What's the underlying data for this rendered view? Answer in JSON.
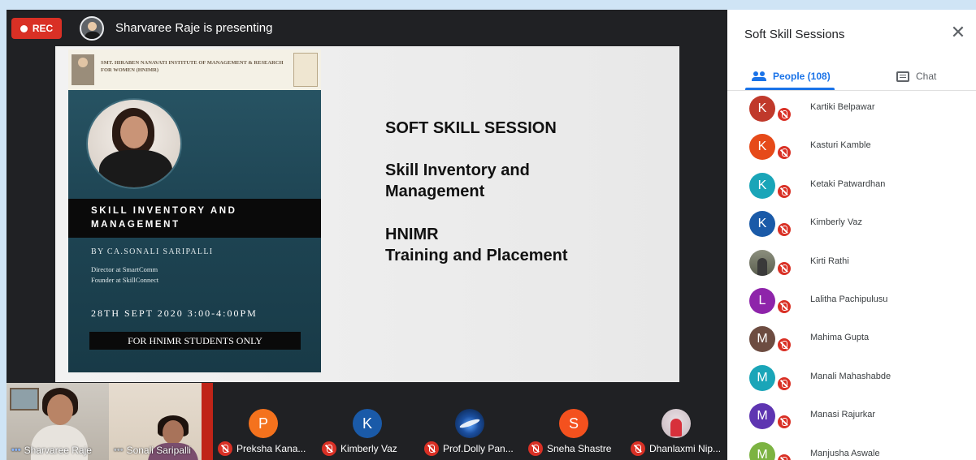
{
  "meeting": {
    "rec_label": "REC",
    "presenting_text": "Sharvaree Raje is presenting"
  },
  "slide": {
    "poster": {
      "institute": "SMT. HIRABEN NANAVATI INSTITUTE OF MANAGEMENT & RESEARCH FOR WOMEN (HNIMR)",
      "title_line1": "SKILL INVENTORY AND",
      "title_line2": "MANAGEMENT",
      "by": "BY CA.SONALI SARIPALLI",
      "role1": "Director at SmartComm",
      "role2": "Founder at SkillConnect",
      "date": "28TH SEPT 2020 3:00-4:00PM",
      "students": "FOR HNIMR STUDENTS ONLY"
    },
    "heading": "SOFT SKILL SESSION",
    "topic_line1": "Skill Inventory and",
    "topic_line2": "Management",
    "org_line1": "HNIMR",
    "org_line2": "Training and Placement"
  },
  "tiles": {
    "video": [
      {
        "name": "Sharvaree Raje"
      },
      {
        "name": "Sonali Saripalli"
      }
    ],
    "participants": [
      {
        "initial": "P",
        "name": "Preksha Kana...",
        "color": "#f4721d",
        "avatar": "letter"
      },
      {
        "initial": "K",
        "name": "Kimberly Vaz",
        "color": "#1a5aa8",
        "avatar": "letter"
      },
      {
        "initial": "",
        "name": "Prof.Dolly Pan...",
        "color": "#0f2f62",
        "avatar": "dolly"
      },
      {
        "initial": "S",
        "name": "Sneha Shastre",
        "color": "#f4511e",
        "avatar": "letter"
      },
      {
        "initial": "",
        "name": "Dhanlaxmi Nip...",
        "color": "#c9bcc2",
        "avatar": "dhan"
      }
    ]
  },
  "panel": {
    "title": "Soft Skill Sessions",
    "close_label": "✕",
    "people_tab": "People (108)",
    "chat_tab": "Chat",
    "people": [
      {
        "initial": "K",
        "name": "Kartiki Belpawar",
        "color": "#c0392b",
        "avatar": "letter"
      },
      {
        "initial": "K",
        "name": "Kasturi Kamble",
        "color": "#e64a19",
        "avatar": "letter"
      },
      {
        "initial": "K",
        "name": "Ketaki Patwardhan",
        "color": "#1aa5b8",
        "avatar": "letter"
      },
      {
        "initial": "K",
        "name": "Kimberly Vaz",
        "color": "#1a5aa8",
        "avatar": "letter"
      },
      {
        "initial": "",
        "name": "Kirti Rathi",
        "color": "#7a7d6c",
        "avatar": "photo"
      },
      {
        "initial": "L",
        "name": "Lalitha Pachipulusu",
        "color": "#8e24aa",
        "avatar": "letter"
      },
      {
        "initial": "M",
        "name": "Mahima Gupta",
        "color": "#6d4c41",
        "avatar": "letter"
      },
      {
        "initial": "M",
        "name": "Manali Mahashabde",
        "color": "#1aa5b8",
        "avatar": "letter"
      },
      {
        "initial": "M",
        "name": "Manasi Rajurkar",
        "color": "#5e35b1",
        "avatar": "letter"
      },
      {
        "initial": "M",
        "name": "Manjusha Aswale",
        "color": "#7cb342",
        "avatar": "letter"
      }
    ]
  }
}
